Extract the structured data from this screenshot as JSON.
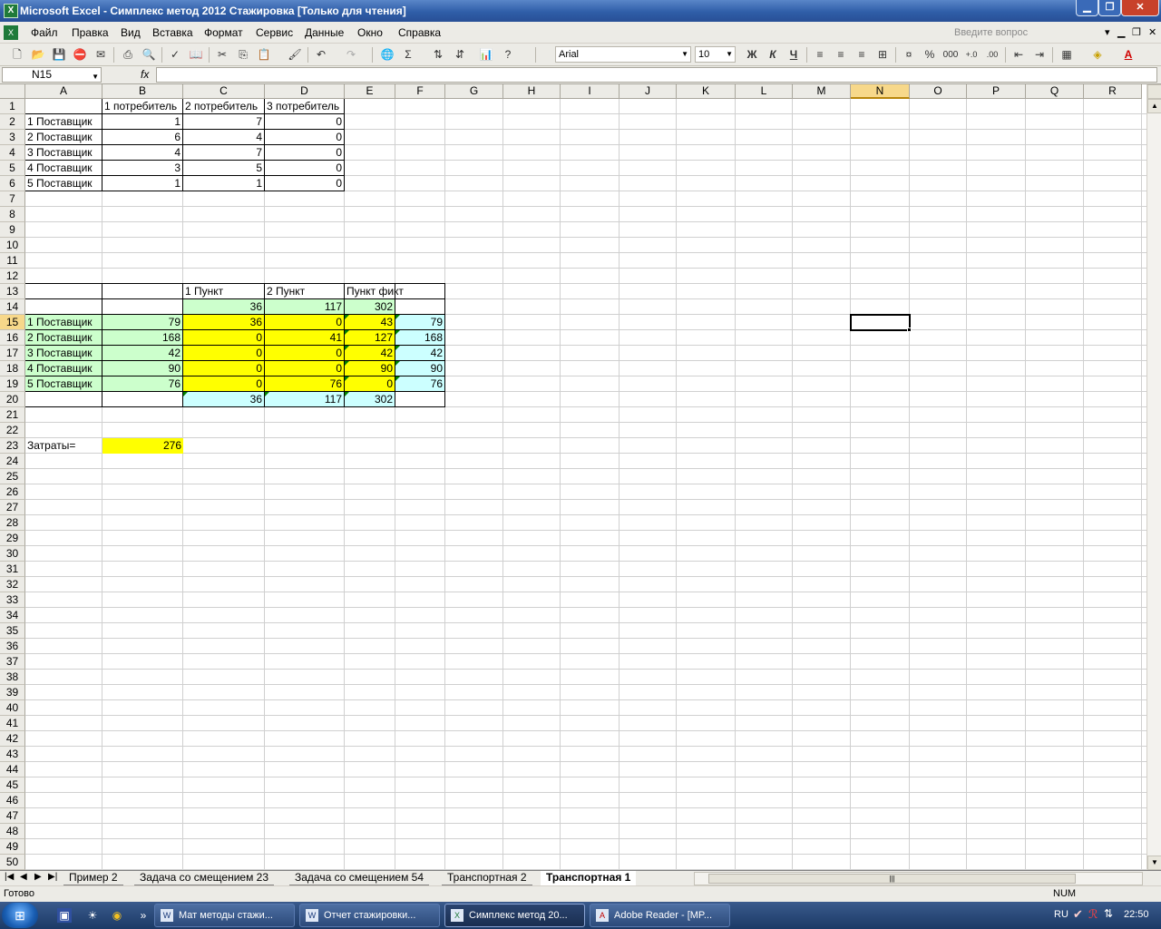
{
  "window": {
    "title": "Microsoft Excel - Симплекс метод 2012 Стажировка  [Только для чтения]"
  },
  "menu": {
    "items": [
      "Файл",
      "Правка",
      "Вид",
      "Вставка",
      "Формат",
      "Сервис",
      "Данные",
      "Окно",
      "Справка"
    ],
    "ask_placeholder": "Введите вопрос"
  },
  "toolbar": {
    "font": "Arial",
    "size": "10",
    "bold": "Ж",
    "italic": "К",
    "underline": "Ч",
    "percent": "%",
    "thousands": "000"
  },
  "formula_bar": {
    "name_box": "N15",
    "fx": "fx",
    "value": ""
  },
  "columns": [
    "A",
    "B",
    "C",
    "D",
    "E",
    "F",
    "G",
    "H",
    "I",
    "J",
    "K",
    "L",
    "M",
    "N",
    "O",
    "P",
    "Q",
    "R"
  ],
  "rows_visible": 50,
  "selected_cell": "N15",
  "cells": {
    "B1": "1 потребитель",
    "C1": "2 потребитель",
    "D1": "3 потребитель",
    "A2": "1 Поставщик",
    "B2": "1",
    "C2": "7",
    "D2": "0",
    "A3": "2 Поставщик",
    "B3": "6",
    "C3": "4",
    "D3": "0",
    "A4": "3 Поставщик",
    "B4": "4",
    "C4": "7",
    "D4": "0",
    "A5": "4 Поставщик",
    "B5": "3",
    "C5": "5",
    "D5": "0",
    "A6": "5 Поставщик",
    "B6": "1",
    "C6": "1",
    "D6": "0",
    "C13": "1 Пункт",
    "D13": "2 Пункт",
    "E13": "Пункт фикт",
    "C14": "36",
    "D14": "117",
    "E14": "302",
    "A15": "1 Поставщик",
    "B15": "79",
    "C15": "36",
    "D15": "0",
    "E15": "43",
    "F15": "79",
    "A16": "2 Поставщик",
    "B16": "168",
    "C16": "0",
    "D16": "41",
    "E16": "127",
    "F16": "168",
    "A17": "3 Поставщик",
    "B17": "42",
    "C17": "0",
    "D17": "0",
    "E17": "42",
    "F17": "42",
    "A18": "4 Поставщик",
    "B18": "90",
    "C18": "0",
    "D18": "0",
    "E18": "90",
    "F18": "90",
    "A19": "5 Поставщик",
    "B19": "76",
    "C19": "0",
    "D19": "76",
    "E19": "0",
    "F19": "76",
    "C20": "36",
    "D20": "117",
    "E20": "302",
    "A23": "Затраты=",
    "B23": "276"
  },
  "sheet_tabs": [
    "Пример 2",
    "Задача со смещением 23",
    "Задача со смещением 54",
    "Транспортная 2",
    "Транспортная 1"
  ],
  "active_tab": "Транспортная 1",
  "status": {
    "left": "Готово",
    "right": "NUM"
  },
  "taskbar": {
    "tasks": [
      "Мат методы стажи...",
      "Отчет стажировки...",
      "Симплекс метод 20...",
      "Adobe Reader - [MP..."
    ],
    "active_task": "Симплекс метод 20...",
    "lang": "RU",
    "clock": "22:50"
  },
  "colors": {
    "green": "#ccffcc",
    "yellow": "#ffff00",
    "cyan": "#ccffff",
    "title_bar": "#2f5ea8"
  }
}
